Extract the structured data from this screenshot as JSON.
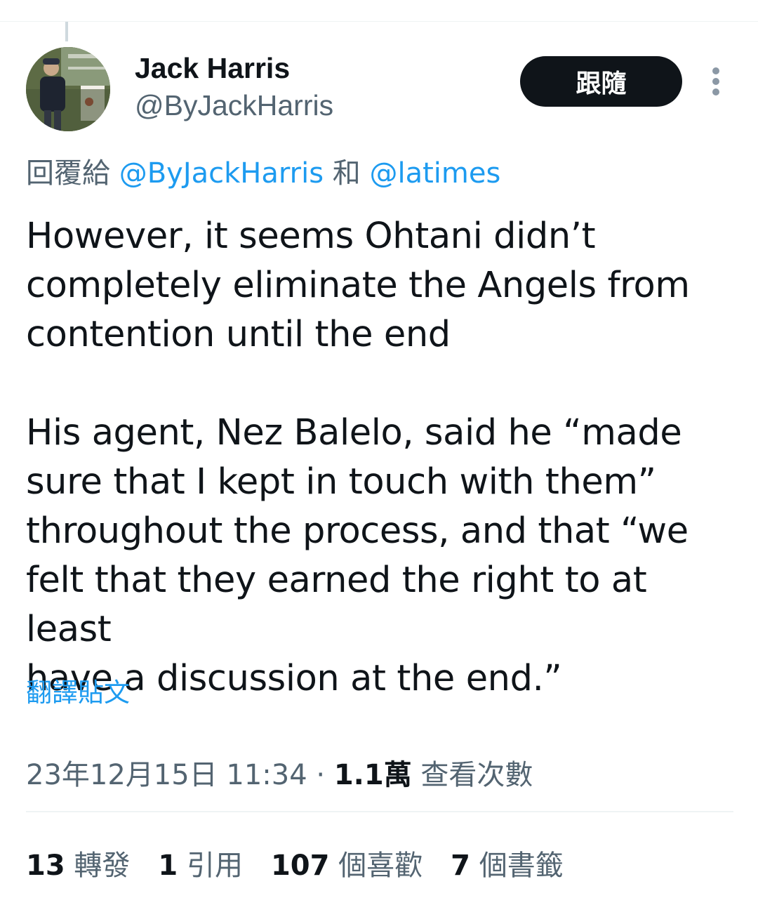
{
  "author": {
    "name": "Jack Harris",
    "handle": "@ByJackHarris",
    "follow_label": "跟隨"
  },
  "reply_to": {
    "prefix": "回覆給",
    "mention_1": "@ByJackHarris",
    "connector": "和",
    "mention_2": "@latimes"
  },
  "tweet": {
    "text": "However, it seems Ohtani didn’t\ncompletely eliminate the Angels from\ncontention until the end\n\nHis agent, Nez Balelo, said he “made\nsure that I kept in touch with them”\nthroughout the process, and that “we\nfelt that they earned the right to at least\nhave a discussion at the end.”",
    "translate_label": "翻譯貼文"
  },
  "meta": {
    "timestamp": "23年12月15日 11:34",
    "separator": "·",
    "views_count": "1.1萬",
    "views_label": "查看次數"
  },
  "stats": [
    {
      "count": "13",
      "label": "轉發"
    },
    {
      "count": "1",
      "label": "引用"
    },
    {
      "count": "107",
      "label": "個喜歡"
    },
    {
      "count": "7",
      "label": "個書籤"
    }
  ],
  "colors": {
    "link": "#1d9bf0",
    "secondary_text": "#536471",
    "primary_text": "#0f1419",
    "button_bg": "#0f1419"
  }
}
